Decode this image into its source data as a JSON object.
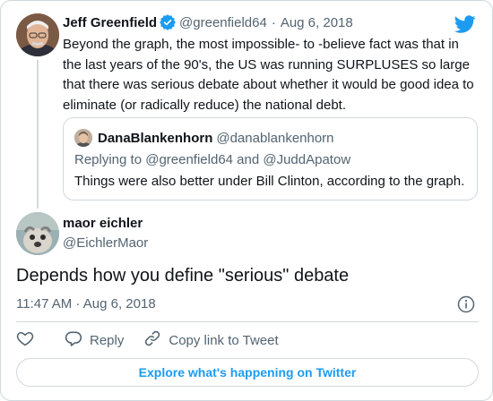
{
  "parent_tweet": {
    "author_name": "Jeff Greenfield",
    "handle": "@greenfield64",
    "separator": "·",
    "date": "Aug 6, 2018",
    "text": "Beyond the graph, the most impossible- to -believe fact was that in the last years of the 90's, the US was running SURPLUSES so large that there was serious debate about whether it would be good idea to eliminate (or radically reduce) the national debt."
  },
  "quoted_tweet": {
    "author_name": "DanaBlankenhorn",
    "handle": "@danablankenhorn",
    "replying_to": "Replying to @greenfield64 and @JuddApatow",
    "text": "Things were also better under Bill Clinton, according to the graph."
  },
  "reply_tweet": {
    "author_name": "maor eichler",
    "handle": "@EichlerMaor",
    "text": "Depends how you define \"serious\" debate",
    "timestamp": "11:47 AM · Aug 6, 2018"
  },
  "actions": {
    "reply_label": "Reply",
    "copy_link_label": "Copy link to Tweet"
  },
  "explore_label": "Explore what's happening on Twitter",
  "icons": {
    "brand": "twitter-bird-icon",
    "verified": "verified-badge-icon",
    "info": "info-icon",
    "like": "heart-icon",
    "reply": "reply-bubble-icon",
    "copy_link": "link-icon"
  },
  "colors": {
    "accent": "#1d9bf0",
    "text_primary": "#0f1419",
    "text_secondary": "#536471",
    "border": "#cfd9de"
  }
}
